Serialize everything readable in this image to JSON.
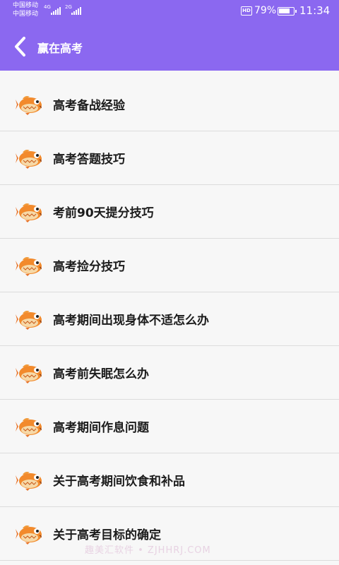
{
  "status_bar": {
    "carrier1": "中国移动",
    "carrier2": "中国移动",
    "net1": "4G",
    "net2": "2G",
    "hd": "HD",
    "battery": "79%",
    "battery_level": 0.79,
    "time": "11:34"
  },
  "header": {
    "title": "赢在高考",
    "color": "#8b68f0"
  },
  "list": {
    "item_icon": "fish-icon",
    "items": [
      {
        "label": "高考备战经验"
      },
      {
        "label": "高考答题技巧"
      },
      {
        "label": "考前90天提分技巧"
      },
      {
        "label": "高考捡分技巧"
      },
      {
        "label": "高考期间出现身体不适怎么办"
      },
      {
        "label": "高考前失眠怎么办"
      },
      {
        "label": "高考期间作息问题"
      },
      {
        "label": "关于高考期间饮食和补品"
      },
      {
        "label": "关于高考目标的确定"
      }
    ]
  },
  "watermark": "趣美汇软件 • ZJHHRJ.COM"
}
